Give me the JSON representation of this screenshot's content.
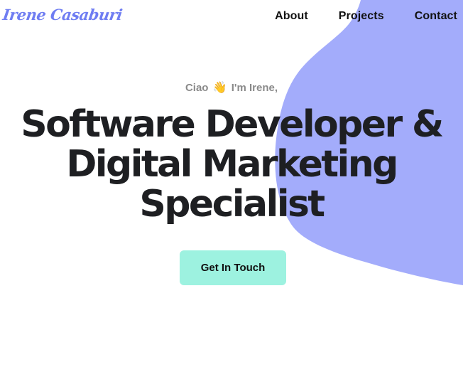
{
  "header": {
    "logo_text": "Irene Casaburi",
    "nav": [
      {
        "label": "About"
      },
      {
        "label": "Projects"
      },
      {
        "label": "Contact"
      }
    ]
  },
  "hero": {
    "greeting_prefix": "Ciao",
    "greeting_emoji": "👋",
    "greeting_suffix": "I'm Irene,",
    "headline_lines": [
      "Software Developer &",
      "Digital Marketing",
      "Specialist"
    ],
    "cta_label": "Get In Touch"
  },
  "colors": {
    "accent_blob": "#a3acfb",
    "logo": "#6f7df2",
    "cta_background": "#9df2e0",
    "heading": "#1e1f22",
    "greeting": "#8a8a8a"
  },
  "icons": {
    "greeting_emoji": "waving-hand-icon",
    "background_shape": "decorative-blob"
  }
}
